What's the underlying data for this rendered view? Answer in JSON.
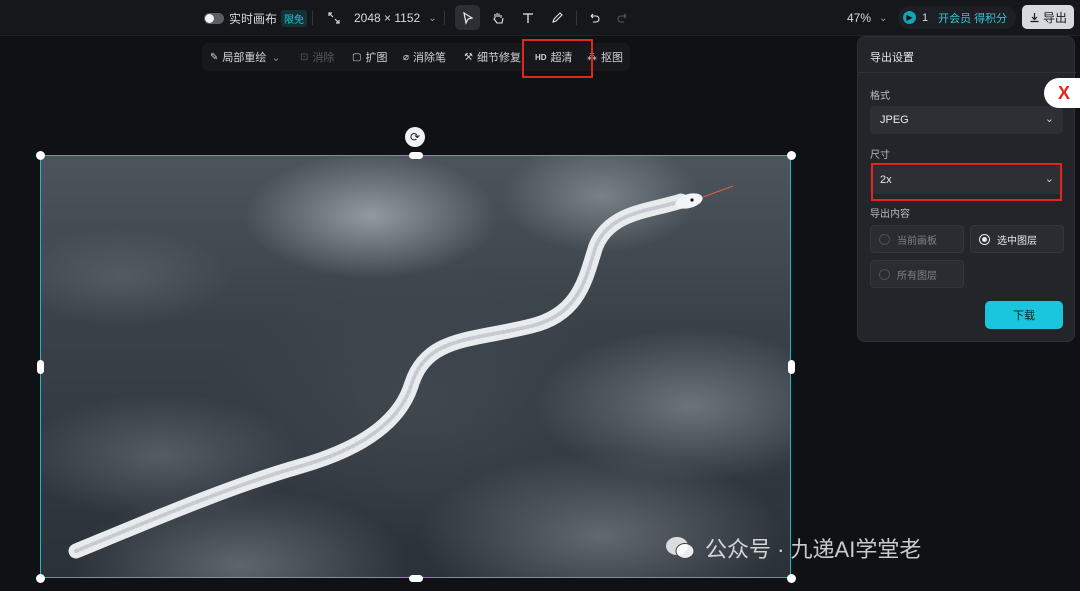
{
  "topbar": {
    "realtime_canvas_label": "实时画布",
    "limit_badge": "限免",
    "canvas_size": "2048 × 1152",
    "zoom": "47%",
    "credits_count": "1",
    "credits_text": "开会员 得积分",
    "export_label": "导出"
  },
  "subtoolbar": {
    "items": [
      {
        "label": "局部重绘",
        "icon": "brush-icon"
      },
      {
        "label": "消除",
        "icon": "erase-icon",
        "disabled": true
      },
      {
        "label": "扩图",
        "icon": "expand-icon"
      },
      {
        "label": "消除笔",
        "icon": "eraser-pen-icon"
      },
      {
        "label": "细节修复",
        "icon": "magic-icon"
      },
      {
        "label": "超清",
        "icon": "hd-icon",
        "prefix": "HD"
      },
      {
        "label": "抠图",
        "icon": "cutout-icon"
      }
    ]
  },
  "export_panel": {
    "title": "导出设置",
    "format_label": "格式",
    "format_value": "JPEG",
    "size_label": "尺寸",
    "size_value": "2x",
    "content_label": "导出内容",
    "options": [
      {
        "label": "当前画板",
        "selected": false
      },
      {
        "label": "选中图层",
        "selected": true
      },
      {
        "label": "所有图层",
        "selected": false
      }
    ],
    "download_label": "下载"
  },
  "watermark": {
    "text": "公众号 · 九递AI学堂老"
  },
  "colors": {
    "accent": "#19c6dd",
    "highlight_red": "#e1261c",
    "selection": "#25b7b9"
  }
}
